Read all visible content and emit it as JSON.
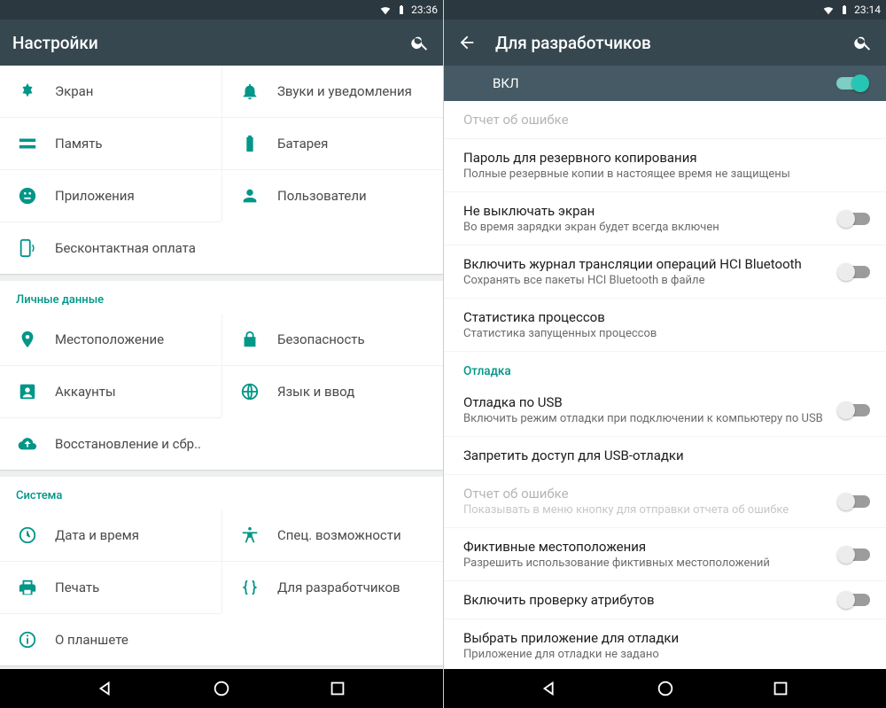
{
  "left": {
    "status_time": "23:36",
    "title": "Настройки",
    "sections": [
      {
        "header": null,
        "items": [
          {
            "id": "display",
            "label": "Экран"
          },
          {
            "id": "sound",
            "label": "Звуки и уведомления"
          },
          {
            "id": "memory",
            "label": "Память"
          },
          {
            "id": "battery",
            "label": "Батарея"
          },
          {
            "id": "apps",
            "label": "Приложения"
          },
          {
            "id": "users",
            "label": "Пользователи"
          },
          {
            "id": "nfc",
            "label": "Бесконтактная оплата"
          }
        ]
      },
      {
        "header": "Личные данные",
        "items": [
          {
            "id": "location",
            "label": "Местоположение"
          },
          {
            "id": "security",
            "label": "Безопасность"
          },
          {
            "id": "accounts",
            "label": "Аккаунты"
          },
          {
            "id": "language",
            "label": "Язык и ввод"
          },
          {
            "id": "backup",
            "label": "Восстановление и сбр.."
          }
        ]
      },
      {
        "header": "Система",
        "items": [
          {
            "id": "datetime",
            "label": "Дата и время"
          },
          {
            "id": "accessibility",
            "label": "Спец. возможности"
          },
          {
            "id": "print",
            "label": "Печать"
          },
          {
            "id": "developer",
            "label": "Для разработчиков"
          },
          {
            "id": "about",
            "label": "О планшете"
          }
        ]
      }
    ]
  },
  "right": {
    "status_time": "23:14",
    "title": "Для разработчиков",
    "master_label": "ВКЛ",
    "master_on": true,
    "subheader_debug": "Отладка",
    "items": [
      {
        "title": "Отчет об ошибке",
        "sub": null,
        "toggle": null,
        "disabled": true
      },
      {
        "title": "Пароль для резервного копирования",
        "sub": "Полные резервные копии в настоящее время не защищены",
        "toggle": null
      },
      {
        "title": "Не выключать экран",
        "sub": "Во время зарядки экран будет всегда включен",
        "toggle": false
      },
      {
        "title": "Включить журнал трансляции операций HCI Bluetooth",
        "sub": "Сохранять все пакеты HCI Bluetooth в файле",
        "toggle": false
      },
      {
        "title": "Статистика процессов",
        "sub": "Статистика запущенных процессов",
        "toggle": null
      },
      {
        "title": "Отладка по USB",
        "sub": "Включить режим отладки при подключении к компьютеру по USB",
        "toggle": false
      },
      {
        "title": "Запретить доступ для USB-отладки",
        "sub": null,
        "toggle": null
      },
      {
        "title": "Отчет об ошибке",
        "sub": "Показывать в меню кнопку для отправки отчета об ошибке",
        "toggle": false,
        "disabled": true
      },
      {
        "title": "Фиктивные местоположения",
        "sub": "Разрешить использование фиктивных местоположений",
        "toggle": false
      },
      {
        "title": "Включить проверку атрибутов",
        "sub": null,
        "toggle": false
      },
      {
        "title": "Выбрать приложение для отладки",
        "sub": "Приложение для отладки не задано",
        "toggle": null
      }
    ]
  }
}
